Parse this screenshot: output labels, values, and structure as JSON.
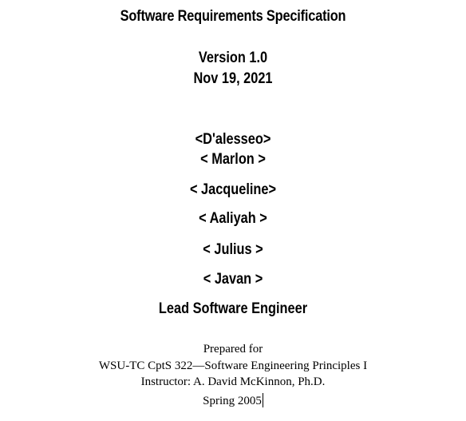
{
  "document": {
    "title": "Software Requirements Specification",
    "version": "Version 1.0",
    "date": "Nov 19, 2021",
    "authors": [
      "<D'alesseo>",
      "< Marlon >",
      "< Jacqueline>",
      "< Aaliyah >",
      "< Julius >",
      "< Javan >"
    ],
    "role": "Lead Software Engineer",
    "prepared": {
      "line1": "Prepared for",
      "line2": "WSU-TC CptS 322—Software Engineering Principles I",
      "line3": "Instructor: A. David McKinnon, Ph.D.",
      "line4": "Spring 2005"
    }
  }
}
